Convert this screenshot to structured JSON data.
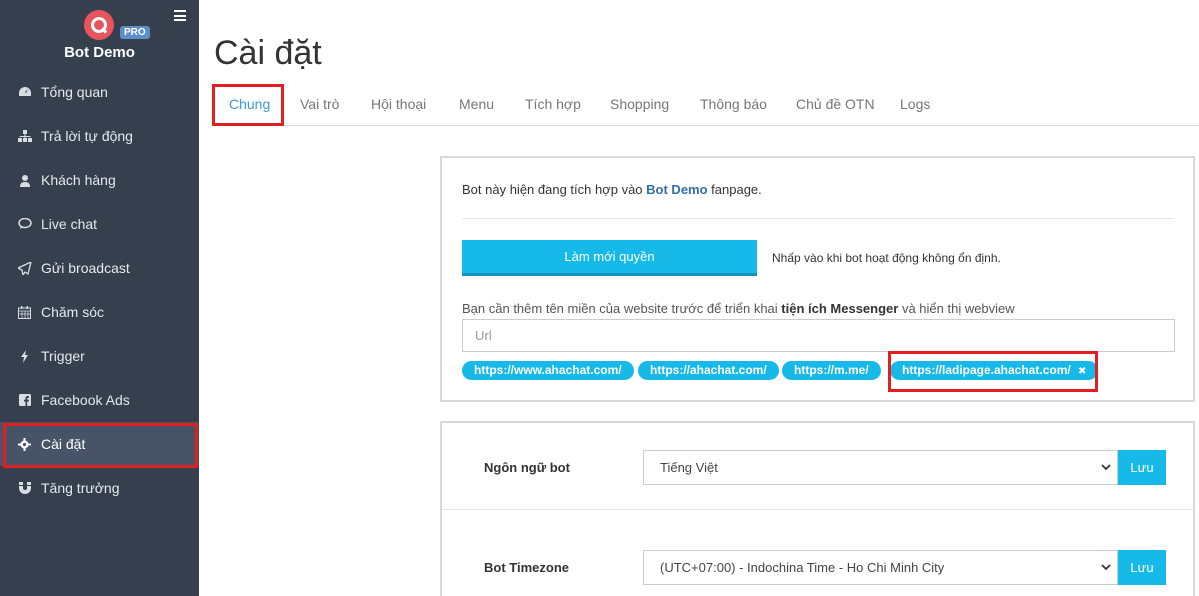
{
  "sidebar": {
    "brand_name": "Bot Demo",
    "badge": "PRO",
    "items": [
      {
        "label": "Tổng quan",
        "icon": "dashboard-icon"
      },
      {
        "label": "Trả lời tự động",
        "icon": "sitemap-icon"
      },
      {
        "label": "Khách hàng",
        "icon": "user-icon"
      },
      {
        "label": "Live chat",
        "icon": "chat-icon"
      },
      {
        "label": "Gửi broadcast",
        "icon": "paper-plane-icon"
      },
      {
        "label": "Chăm sóc",
        "icon": "calendar-icon"
      },
      {
        "label": "Trigger",
        "icon": "bolt-icon"
      },
      {
        "label": "Facebook Ads",
        "icon": "facebook-icon"
      },
      {
        "label": "Cài đặt",
        "icon": "gear-icon",
        "active": true
      },
      {
        "label": "Tăng trưởng",
        "icon": "magnet-icon"
      }
    ]
  },
  "page": {
    "title": "Cài đặt"
  },
  "tabs": [
    "Chung",
    "Vai trò",
    "Hội thoại",
    "Menu",
    "Tích hợp",
    "Shopping",
    "Thông báo",
    "Chủ đề OTN",
    "Logs"
  ],
  "integration": {
    "text_before": "Bot này hiện đang tích hợp vào ",
    "page_name": "Bot Demo",
    "text_after": " fanpage.",
    "refresh_button": "Làm mới quyền",
    "refresh_hint": "Nhấp vào khi bot hoạt động không ổn định.",
    "domain_note_before": "Bạn cần thêm tên miền của website trước để triển khai ",
    "domain_note_bold": "tiện ích Messenger",
    "domain_note_after": " và hiển thị webview",
    "url_placeholder": "Url",
    "domains": [
      "https://www.ahachat.com/",
      "https://ahachat.com/",
      "https://m.me/",
      "https://ladipage.ahachat.com/"
    ],
    "remove_symbol": "✖"
  },
  "settings": {
    "language_label": "Ngôn ngữ bot",
    "language_value": "Tiếng Việt",
    "timezone_label": "Bot Timezone",
    "timezone_value": "(UTC+07:00) - Indochina Time - Ho Chi Minh City",
    "save_label": "Lưu"
  },
  "colors": {
    "sidebar_bg": "#363f4d",
    "accent": "#17b9e8",
    "highlight": "#e02020",
    "active_tab": "#3b9bd5"
  }
}
